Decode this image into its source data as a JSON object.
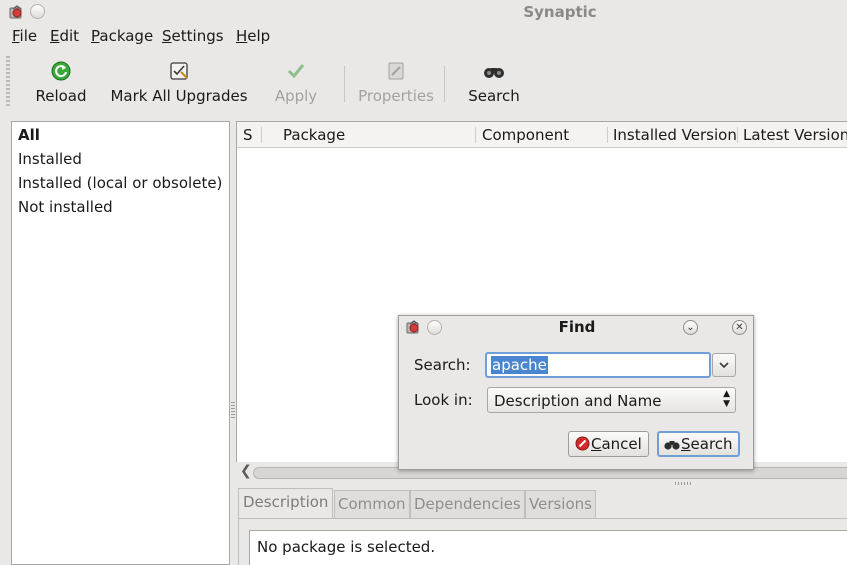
{
  "window": {
    "title": "Synaptic"
  },
  "menubar": {
    "items": [
      {
        "pre": "",
        "ul": "F",
        "post": "ile"
      },
      {
        "pre": "",
        "ul": "E",
        "post": "dit"
      },
      {
        "pre": "",
        "ul": "P",
        "post": "ackage"
      },
      {
        "pre": "",
        "ul": "S",
        "post": "ettings"
      },
      {
        "pre": "",
        "ul": "H",
        "post": "elp"
      }
    ]
  },
  "toolbar": {
    "reload": "Reload",
    "mark_all_upgrades": "Mark All Upgrades",
    "apply": "Apply",
    "properties": "Properties",
    "search": "Search"
  },
  "filters": {
    "items": [
      "All",
      "Installed",
      "Installed (local or obsolete)",
      "Not installed"
    ],
    "selected": "All"
  },
  "package_list": {
    "columns": [
      "S",
      "Package",
      "Component",
      "Installed Version",
      "Latest Version"
    ]
  },
  "details": {
    "tabs": [
      "Description",
      "Common",
      "Dependencies",
      "Versions"
    ],
    "active_tab": "Description",
    "description_text": "No package is selected."
  },
  "find_dialog": {
    "title": "Find",
    "search_label": "Search:",
    "search_value": "apache",
    "look_in_label": "Look in:",
    "look_in_value": "Description and Name",
    "cancel_pre": "",
    "cancel_ul": "C",
    "cancel_post": "ancel",
    "search_btn_pre": "",
    "search_btn_ul": "S",
    "search_btn_post": "earch"
  },
  "colors": {
    "accent": "#4a86d0",
    "reload_green": "#2f9e2f",
    "cancel_red": "#d42a2a"
  }
}
